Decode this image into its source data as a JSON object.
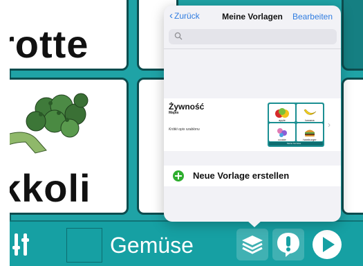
{
  "background_cards": {
    "word_top": "rotte",
    "word_bottom": "kkoli"
  },
  "toolbar": {
    "title": "Gemüse"
  },
  "popover": {
    "back_label": "Zurück",
    "title": "Meine Vorlagen",
    "edit_label": "Bearbeiten",
    "search_placeholder": "",
    "template": {
      "name": "Żywność",
      "author": "Mapia",
      "description": "Krótki opis szablonu",
      "thumbnail": {
        "cells": [
          "apple",
          "banana",
          "cookie",
          "hamburger"
        ],
        "bar_text": "Meine Gemüse"
      }
    },
    "new_template_label": "Neue Vorlage erstellen"
  },
  "colors": {
    "teal": "#1fa3a6",
    "accent_blue": "#2f7ce0",
    "add_green": "#2fae2f"
  }
}
